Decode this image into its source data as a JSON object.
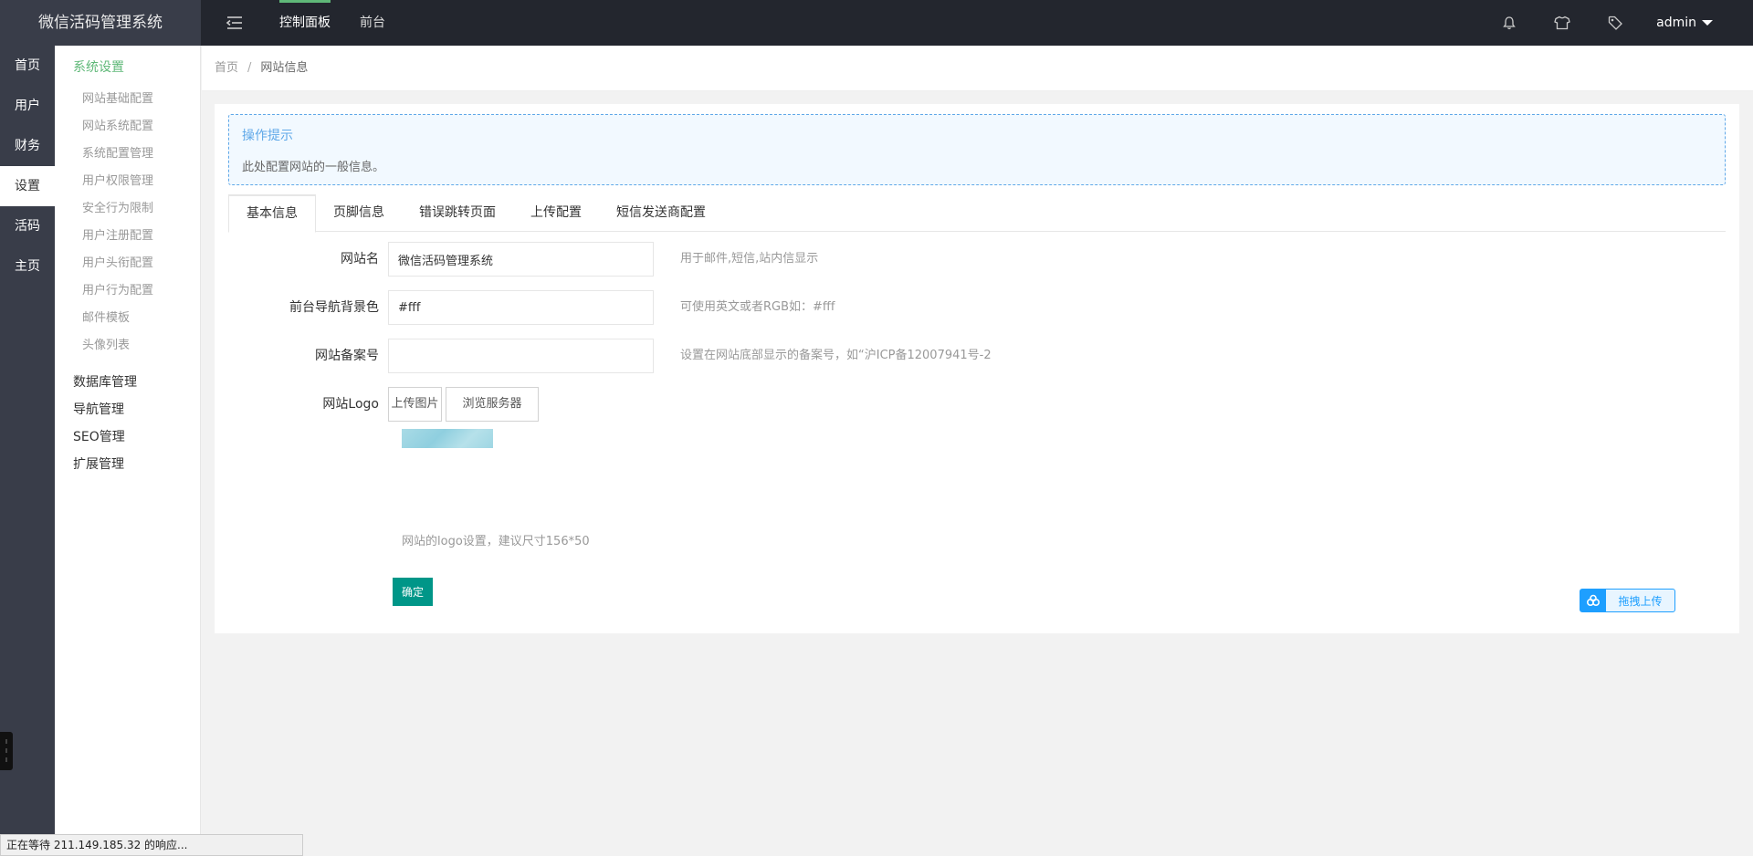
{
  "app": {
    "title": "微信活码管理系统"
  },
  "top_nav": {
    "items": [
      "控制面板",
      "前台"
    ],
    "active_index": 0
  },
  "user": {
    "name": "admin"
  },
  "rail": {
    "items": [
      "首页",
      "用户",
      "财务",
      "设置",
      "活码",
      "主页"
    ],
    "active_index": 3
  },
  "sidebar": {
    "group_title": "系统设置",
    "items": [
      "网站基础配置",
      "网站系统配置",
      "系统配置管理",
      "用户权限管理",
      "安全行为限制",
      "用户注册配置",
      "用户头衔配置",
      "用户行为配置",
      "邮件模板",
      "头像列表"
    ],
    "sections": [
      "数据库管理",
      "导航管理",
      "SEO管理",
      "扩展管理"
    ]
  },
  "breadcrumb": {
    "home": "首页",
    "separator": "/",
    "current": "网站信息"
  },
  "tip": {
    "title": "操作提示",
    "desc": "此处配置网站的一般信息。"
  },
  "tabs": {
    "items": [
      "基本信息",
      "页脚信息",
      "错误跳转页面",
      "上传配置",
      "短信发送商配置"
    ],
    "active_index": 0
  },
  "form": {
    "site_name": {
      "label": "网站名",
      "value": "微信活码管理系统",
      "hint": "用于邮件,短信,站内信显示"
    },
    "nav_bg": {
      "label": "前台导航背景色",
      "value": "#fff",
      "hint": "可使用英文或者RGB如：#fff"
    },
    "icp": {
      "label": "网站备案号",
      "value": "",
      "hint": "设置在网站底部显示的备案号，如“沪ICP备12007941号-2"
    },
    "logo": {
      "label": "网站Logo",
      "upload_label": "上传图片",
      "browse_label": "浏览服务器",
      "hint": "网站的logo设置，建议尺寸156*50"
    },
    "submit_label": "确定"
  },
  "drag_upload": {
    "label": "拖拽上传"
  },
  "status_bar": {
    "text": "正在等待 211.149.185.32 的响应..."
  },
  "colors": {
    "topbar": "#23262e",
    "rail": "#393d49",
    "accent_green": "#5fb878",
    "primary": "#009688",
    "info_blue": "#5fa8e8"
  }
}
